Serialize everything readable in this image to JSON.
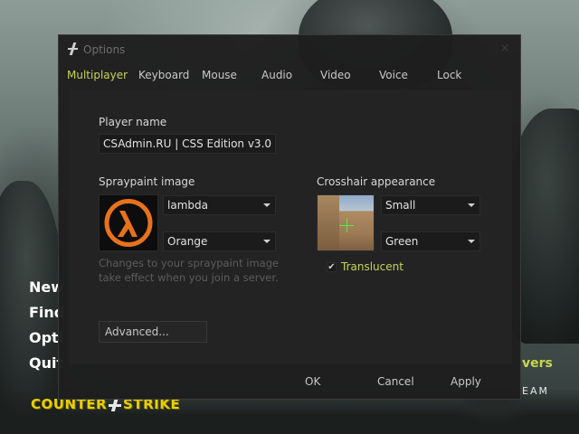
{
  "main_menu": {
    "items": [
      "New",
      "Find",
      "Opti",
      "Quit"
    ],
    "right_text": "vers",
    "team_text": "EAM",
    "logo_left": "COUNTER",
    "logo_right": "STRIKE"
  },
  "dialog": {
    "title": "Options",
    "close_glyph": "×",
    "tabs": [
      {
        "label": "Multiplayer",
        "active": true
      },
      {
        "label": "Keyboard",
        "active": false
      },
      {
        "label": "Mouse",
        "active": false
      },
      {
        "label": "Audio",
        "active": false
      },
      {
        "label": "Video",
        "active": false
      },
      {
        "label": "Voice",
        "active": false
      },
      {
        "label": "Lock",
        "active": false
      }
    ],
    "player_name": {
      "label": "Player name",
      "value": "CSAdmin.RU | CSS Edition v3.0"
    },
    "spraypaint": {
      "label": "Spraypaint image",
      "image_value": "lambda",
      "color_value": "Orange",
      "hint": "Changes to your spraypaint image take effect when you join a server."
    },
    "crosshair": {
      "label": "Crosshair appearance",
      "size_value": "Small",
      "color_value": "Green",
      "translucent_label": "Translucent",
      "translucent_checked": true,
      "check_glyph": "✔"
    },
    "advanced_button": "Advanced...",
    "footer": {
      "ok": "OK",
      "cancel": "Cancel",
      "apply": "Apply"
    }
  },
  "colors": {
    "accent_green": "#c4d456",
    "spray_orange": "#e8721c",
    "crosshair_green": "#4ef04e",
    "logo_yellow": "#e8d000"
  },
  "icons": {
    "title": "counter-strike-icon",
    "spray": "half-life-lambda-icon",
    "dropdown": "chevron-down-icon",
    "check": "check-icon"
  }
}
